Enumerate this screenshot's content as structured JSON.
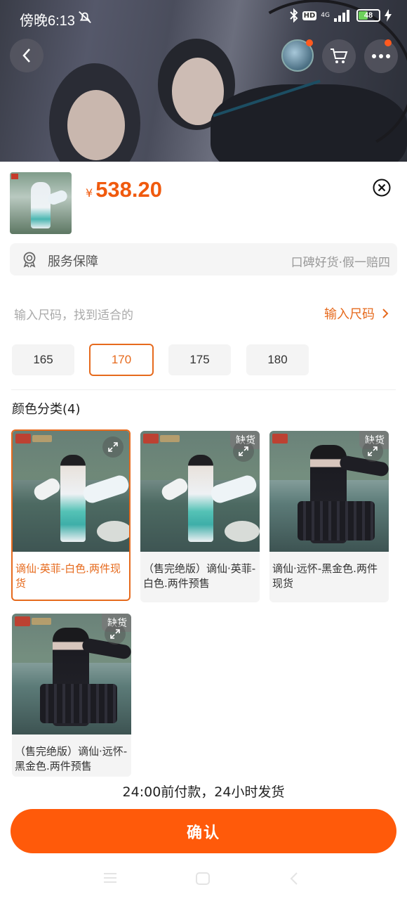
{
  "status_bar": {
    "time": "傍晚6:13",
    "hd_badge": "HD",
    "network": "4G",
    "battery": "48",
    "battery_level": 0.48
  },
  "top_actions": {
    "back_icon": "chevron-left-icon",
    "avatar": "shop-avatar",
    "cart_icon": "cart-icon",
    "more_icon": "more-dots-icon"
  },
  "product": {
    "currency": "¥",
    "price": "538.20"
  },
  "service": {
    "label": "服务保障",
    "description": "口碑好货·假一赔四"
  },
  "size": {
    "hint": "输入尺码，找到适合的",
    "link": "输入尺码",
    "options": [
      "165",
      "170",
      "175",
      "180"
    ],
    "selected": "170"
  },
  "color": {
    "title": "颜色分类(4)",
    "out_of_stock_label": "缺货",
    "items": [
      {
        "name": "谪仙·英菲-白色.两件现货",
        "selected": true,
        "out_of_stock": false
      },
      {
        "name": "（售完绝版）谪仙·英菲-白色.两件预售",
        "selected": false,
        "out_of_stock": true
      },
      {
        "name": "谪仙·远怀-黑金色.两件现货",
        "selected": false,
        "out_of_stock": true
      },
      {
        "name": "（售完绝版）谪仙·远怀-黑金色.两件预售",
        "selected": false,
        "out_of_stock": true
      }
    ]
  },
  "footer": {
    "shipping_note": "24:00前付款，24小时发货",
    "confirm_label": "确认"
  },
  "colors": {
    "accent": "#ff5a0a",
    "price": "#f05a0e",
    "selected_border": "#e66a1d"
  }
}
